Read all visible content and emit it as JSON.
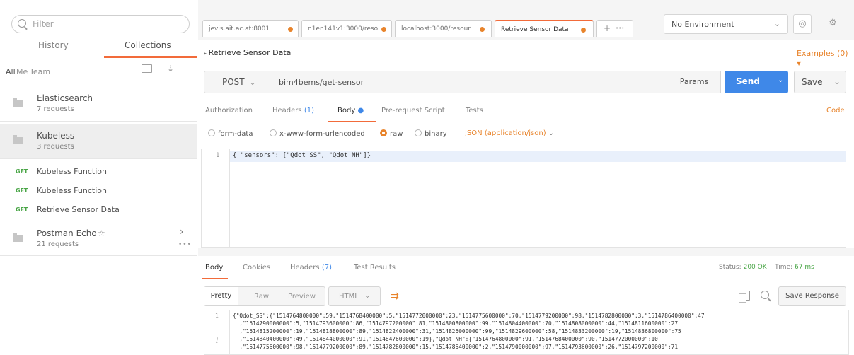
{
  "sidebar": {
    "search_placeholder": "Filter",
    "tabs": [
      "History",
      "Collections"
    ],
    "filters": [
      "All",
      "Me",
      "Team"
    ],
    "collections": [
      {
        "name": "Elasticsearch",
        "count": "7 requests"
      },
      {
        "name": "Kubeless",
        "count": "3 requests"
      }
    ],
    "requests": [
      {
        "method": "GET",
        "name": "Kubeless Function"
      },
      {
        "method": "GET",
        "name": "Kubeless Function"
      },
      {
        "method": "GET",
        "name": "Retrieve Sensor Data"
      }
    ],
    "echo": {
      "name": "Postman Echo",
      "star": "☆",
      "count": "21 requests",
      "chevron": "›",
      "dots": "•••"
    }
  },
  "tabs": [
    {
      "label": "jevis.ait.ac.at:8001"
    },
    {
      "label": "n1en141v1:3000/reso"
    },
    {
      "label": "localhost:3000/resour"
    },
    {
      "label": "Retrieve Sensor Data"
    }
  ],
  "tab_add": "+",
  "tab_more": "•••",
  "environment": {
    "label": "No Environment"
  },
  "request": {
    "breadcrumb": "Retrieve Sensor Data",
    "examples": "Examples (0)",
    "method": "POST",
    "url": "bim4bems/get-sensor",
    "params": "Params",
    "send": "Send",
    "save": "Save",
    "tabs": {
      "authorization": "Authorization",
      "headers": "Headers",
      "headers_count": "(1)",
      "body": "Body",
      "prescript": "Pre-request Script",
      "tests": "Tests"
    },
    "code": "Code",
    "body_modes": {
      "formdata": "form-data",
      "urlencoded": "x-www-form-urlencoded",
      "raw": "raw",
      "binary": "binary",
      "content_type": "JSON (application/json)"
    },
    "editor_line_no": "1",
    "editor_text": "{ \"sensors\": [\"Qdot_SS\", \"Qdot_NH\"]}"
  },
  "response": {
    "tabs": {
      "body": "Body",
      "cookies": "Cookies",
      "headers": "Headers",
      "headers_count": "(7)",
      "tests": "Test Results"
    },
    "status_label": "Status:",
    "status_value": "200 OK",
    "time_label": "Time:",
    "time_value": "67 ms",
    "views": [
      "Pretty",
      "Raw",
      "Preview"
    ],
    "format": "HTML",
    "save_response": "Save Response",
    "line_no": "1",
    "info_glyph": "i",
    "lines": [
      "{\"Qdot_SS\":{\"1514764800000\":59,\"1514768400000\":5,\"1514772000000\":23,\"1514775600000\":70,\"1514779200000\":98,\"1514782800000\":3,\"1514786400000\":47",
      "  ,\"1514790000000\":5,\"1514793600000\":86,\"1514797200000\":81,\"1514800800000\":99,\"1514804400000\":70,\"1514808000000\":44,\"1514811600000\":27",
      "  ,\"1514815200000\":19,\"1514818800000\":89,\"1514822400000\":31,\"1514826000000\":99,\"1514829600000\":58,\"1514833200000\":19,\"1514836800000\":75",
      "  ,\"1514840400000\":49,\"1514844000000\":91,\"1514847600000\":19},\"Qdot_NH\":{\"1514764800000\":91,\"1514768400000\":90,\"1514772000000\":10",
      "  ,\"1514775600000\":98,\"1514779200000\":89,\"1514782800000\":15,\"1514786400000\":2,\"1514790000000\":97,\"1514793600000\":26,\"1514797200000\":71"
    ]
  },
  "colors": {
    "accent": "#f26b3a",
    "orange": "#e8842c",
    "send": "#3f88e8",
    "get": "#49a546"
  }
}
